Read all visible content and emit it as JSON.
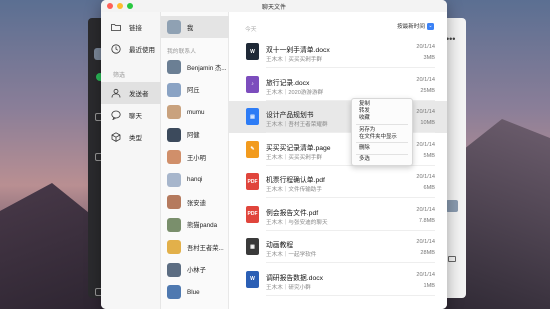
{
  "window": {
    "title": "聊天文件"
  },
  "sidebar": {
    "items": [
      {
        "label": "链接",
        "icon": "folder-icon"
      },
      {
        "label": "最近使用",
        "icon": "clock-icon"
      }
    ],
    "section": "筛选",
    "filters": [
      {
        "label": "发送者",
        "icon": "person-icon",
        "active": true
      },
      {
        "label": "聊天",
        "icon": "chat-icon",
        "active": false
      },
      {
        "label": "类型",
        "icon": "cube-icon",
        "active": false
      }
    ]
  },
  "contacts": {
    "me": "我",
    "section": "我的联系人",
    "items": [
      {
        "name": "Benjamin 杰...",
        "color": "#6b7f94"
      },
      {
        "name": "阿丘",
        "color": "#8aa3c4"
      },
      {
        "name": "mumu",
        "color": "#c9a27e"
      },
      {
        "name": "阿健",
        "color": "#3c4a5c"
      },
      {
        "name": "王小明",
        "color": "#d08f6a"
      },
      {
        "name": "hanqi",
        "color": "#a7b6cc"
      },
      {
        "name": "张安迪",
        "color": "#b57a5e"
      },
      {
        "name": "熊猫panda",
        "color": "#7a8f6c"
      },
      {
        "name": "吾村王者荣...",
        "color": "#e2b04a"
      },
      {
        "name": "小林子",
        "color": "#5c6d82"
      },
      {
        "name": "Blue",
        "color": "#4f79b0"
      }
    ]
  },
  "files_panel": {
    "today": "今天",
    "sort_label": "按最新时间",
    "files": [
      {
        "name": "双十一剁手清单.docx",
        "meta": "王木木｜买买买剁手群",
        "date": "20/1/14",
        "size": "3MB",
        "icon": "word-icon",
        "color": "#1f2937",
        "badge": "W"
      },
      {
        "name": "旅行记录.docx",
        "meta": "王木木｜2020游游游群",
        "date": "20/1/14",
        "size": "25MB",
        "icon": "audio-icon",
        "color": "#7c4dbd",
        "badge": "♪"
      },
      {
        "name": "设计产品规划书",
        "meta": "王木木｜吾村王者荣耀群",
        "date": "20/1/14",
        "size": "10MB",
        "icon": "doc-icon",
        "color": "#2d7cf6",
        "badge": "▤"
      },
      {
        "name": "买买买记录清单.page",
        "meta": "王木木｜买买买剁手群",
        "date": "20/1/14",
        "size": "5MB",
        "icon": "pages-icon",
        "color": "#f29b1e",
        "badge": "✎"
      },
      {
        "name": "机票行程确认单.pdf",
        "meta": "王木木｜文件传输助手",
        "date": "20/1/14",
        "size": "6MB",
        "icon": "pdf-icon",
        "color": "#e0453c",
        "badge": "PDF"
      },
      {
        "name": "例会报告文件.pdf",
        "meta": "王木木｜与张安迪的聊天",
        "date": "20/1/14",
        "size": "7.8MB",
        "icon": "pdf-icon",
        "color": "#e0453c",
        "badge": "PDF"
      },
      {
        "name": "动画教程",
        "meta": "王木木｜一起学软件",
        "date": "20/1/14",
        "size": "28MB",
        "icon": "video-icon",
        "color": "#3a3a3a",
        "badge": "▦"
      },
      {
        "name": "调研报告数据.docx",
        "meta": "王木木｜研究小群",
        "date": "20/1/14",
        "size": "1MB",
        "icon": "word-icon",
        "color": "#2b5fb5",
        "badge": "W"
      }
    ]
  },
  "context_menu": {
    "group1": [
      "复制",
      "转发",
      "收藏"
    ],
    "group2": [
      "另存为",
      "在文件夹中显示"
    ],
    "group3": [
      "删除"
    ],
    "group4": [
      "多选"
    ]
  }
}
